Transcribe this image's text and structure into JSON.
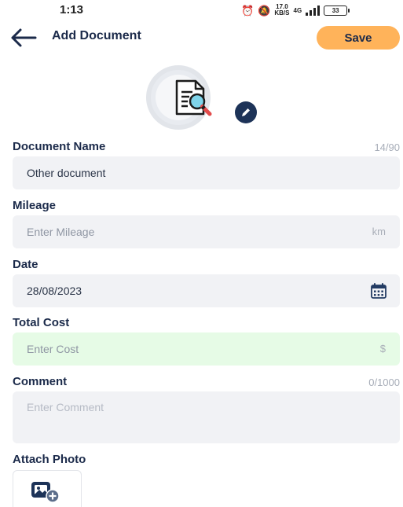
{
  "status_bar": {
    "time": "1:13",
    "net_speed_value": "17.0",
    "net_speed_unit": "KB/S",
    "network": "4G",
    "battery": "33"
  },
  "header": {
    "title": "Add Document",
    "save_label": "Save"
  },
  "colors": {
    "accent": "#ffb35a",
    "navy": "#1d3358",
    "input_bg": "#f1f2f5",
    "cost_bg": "#e6fbe6"
  },
  "form": {
    "document_name": {
      "label": "Document Name",
      "counter": "14/90",
      "value": "Other document"
    },
    "mileage": {
      "label": "Mileage",
      "placeholder": "Enter Mileage",
      "unit": "km"
    },
    "date": {
      "label": "Date",
      "value": "28/08/2023",
      "icon": "calendar-icon"
    },
    "total_cost": {
      "label": "Total Cost",
      "placeholder": "Enter Cost",
      "unit": "$"
    },
    "comment": {
      "label": "Comment",
      "counter": "0/1000",
      "placeholder": "Enter Comment"
    },
    "attach_photo": {
      "label": "Attach Photo",
      "icon": "add-photo-icon"
    }
  }
}
